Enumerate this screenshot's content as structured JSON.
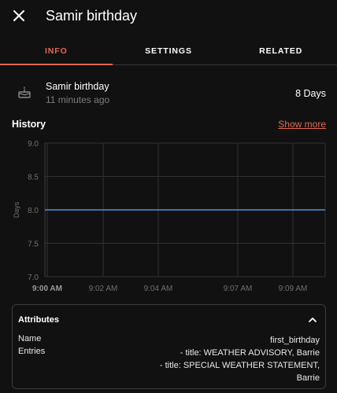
{
  "dialog": {
    "title": "Samir birthday",
    "close_icon": "close-icon"
  },
  "tabs": [
    {
      "label": "INFO",
      "active": true
    },
    {
      "label": "SETTINGS",
      "active": false
    },
    {
      "label": "RELATED",
      "active": false
    }
  ],
  "entity": {
    "icon": "cake-icon",
    "name": "Samir birthday",
    "last_changed": "11 minutes ago",
    "state": "8 Days"
  },
  "history": {
    "title": "History",
    "show_more": "Show more"
  },
  "chart_data": {
    "type": "line",
    "ylabel": "Days",
    "ylim": [
      7.0,
      9.0
    ],
    "yticks": [
      "9.0",
      "8.5",
      "8.0",
      "7.5",
      "7.0"
    ],
    "xticks": [
      "9:00 AM",
      "9:02 AM",
      "9:04 AM",
      "9:07 AM",
      "9:09 AM"
    ],
    "x": [
      "9:00 AM",
      "9:10 AM"
    ],
    "series": [
      {
        "values": [
          8.0,
          8.0
        ]
      }
    ],
    "line_color": "#4f8fd4",
    "grid": true
  },
  "attributes": {
    "title": "Attributes",
    "rows": [
      {
        "key": "Name",
        "value": [
          "first_birthday"
        ]
      },
      {
        "key": "Entries",
        "value": [
          "- title: WEATHER ADVISORY, Barrie",
          "- title: SPECIAL WEATHER STATEMENT,",
          "Barrie"
        ]
      }
    ]
  },
  "colors": {
    "background": "#111111",
    "accent": "#e06a4f",
    "text": "#ffffff",
    "secondary_text": "#7d7d7d"
  }
}
